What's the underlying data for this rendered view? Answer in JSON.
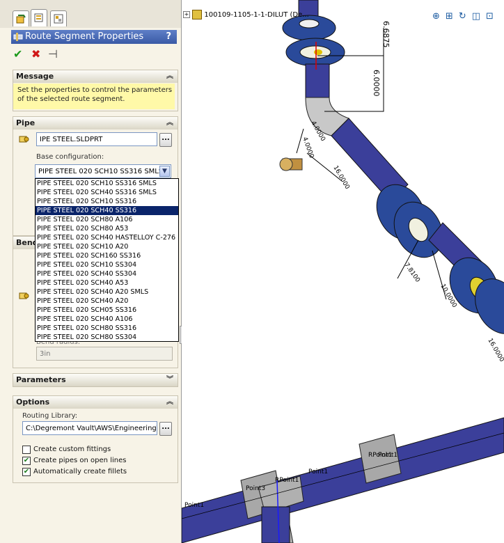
{
  "feature_tabs": [
    "feature-manager-tab",
    "property-manager-tab",
    "configuration-manager-tab"
  ],
  "panel": {
    "title": "Route Segment Properties",
    "help": "?",
    "actions": {
      "ok": "✔",
      "cancel": "✖",
      "pin": "⊣"
    }
  },
  "message": {
    "header": "Message",
    "text": "Set the properties to control the parameters of the selected route segment."
  },
  "pipe": {
    "header": "Pipe",
    "part_file": "IPE STEEL.SLDPRT",
    "browse": "...",
    "config_label": "Base configuration:",
    "config_value": "PIPE STEEL 020 SCH10 SS316 SMLS",
    "options": [
      "PIPE STEEL 020 SCH10 SS316 SMLS",
      "PIPE STEEL 020 SCH40 SS316 SMLS",
      "PIPE STEEL 020 SCH10 SS316",
      "PIPE STEEL 020 SCH40 SS316",
      "PIPE STEEL 020 SCH80 A106",
      "PIPE STEEL 020 SCH80 A53",
      "PIPE STEEL 020 SCH40 HASTELLOY C-276",
      "PIPE STEEL 020 SCH10 A20",
      "PIPE STEEL 020 SCH160 SS316",
      "PIPE STEEL 020 SCH10 SS304",
      "PIPE STEEL 020 SCH40 SS304",
      "PIPE STEEL 020 SCH40 A53",
      "PIPE STEEL 020 SCH40 A20 SMLS",
      "PIPE STEEL 020 SCH40 A20",
      "PIPE STEEL 020 SCH05 SS316",
      "PIPE STEEL 020 SCH40 A106",
      "PIPE STEEL 020 SCH80 SS316",
      "PIPE STEEL 020 SCH80 SS304"
    ],
    "selected_index": 3
  },
  "bend": {
    "header": "Bend",
    "radius_label": "Bend radius:",
    "radius_value": "3in"
  },
  "parameters": {
    "header": "Parameters"
  },
  "options": {
    "header": "Options",
    "library_label": "Routing Library:",
    "library_path": "C:\\Degremont Vault\\AWS\\Engineering\\",
    "checkboxes": [
      {
        "label": "Create custom fittings",
        "checked": false
      },
      {
        "label": "Create pipes on open lines",
        "checked": true
      },
      {
        "label": "Automatically create fillets",
        "checked": true
      }
    ]
  },
  "viewport": {
    "tree_item": "100109-1105-1-1-DILUT (De...",
    "dims": [
      "6.6875",
      "6.0000",
      "4.0000",
      "4.0000",
      "16.0000",
      "7.8100",
      "10.0000",
      "16.0000"
    ],
    "points": [
      "Point1",
      "Point3",
      "RPoint1",
      "Point1",
      "RPoint1",
      "Point1"
    ],
    "colors": {
      "pipe": "#3b3f9a",
      "flange": "#2a4a9a",
      "fitting": "#a8a8a8"
    }
  }
}
